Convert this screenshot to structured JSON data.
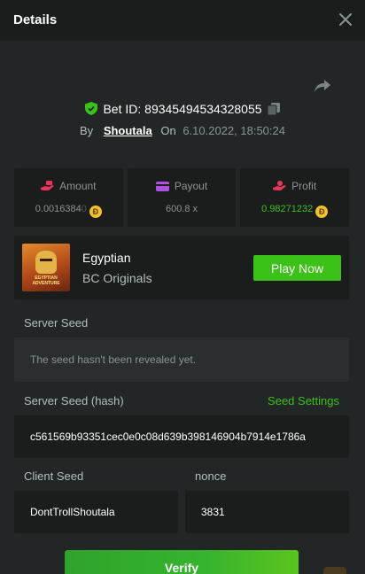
{
  "header": {
    "title": "Details"
  },
  "bet": {
    "id_label": "Bet ID: 89345494534328055",
    "by_label": "By",
    "user": "Shoutala",
    "on_label": "On",
    "date": "6.10.2022, 18:50:24"
  },
  "stats": [
    {
      "label": "Amount",
      "value": "0.0016384",
      "value_fade": "0",
      "icon": "money-hand-icon"
    },
    {
      "label": "Payout",
      "value": "600.8 x",
      "icon": "wallet-icon"
    },
    {
      "label": "Profit",
      "value": "0.98271232",
      "icon": "profit-hand-icon"
    }
  ],
  "coin_glyph": "Ð",
  "game": {
    "name": "Egyptian",
    "provider": "BC Originals",
    "thumb_text": "EGYPTIAN ADVENTURE",
    "play_label": "Play Now"
  },
  "server_seed": {
    "label": "Server Seed",
    "placeholder": "The seed hasn't been revealed yet."
  },
  "server_seed_hash": {
    "label": "Server Seed (hash)",
    "settings_label": "Seed Settings",
    "value": "c561569b93351cec0e0c08d639b398146904b7914e1786a"
  },
  "client_seed": {
    "label": "Client Seed",
    "value": "DontTrollShoutala"
  },
  "nonce": {
    "label": "nonce",
    "value": "3831"
  },
  "verify_label": "Verify",
  "colors": {
    "accent": "#3bc117",
    "background": "#232626",
    "panel": "#1b1d1d",
    "coin": "#f2c12e",
    "loss": "#e8355a"
  }
}
